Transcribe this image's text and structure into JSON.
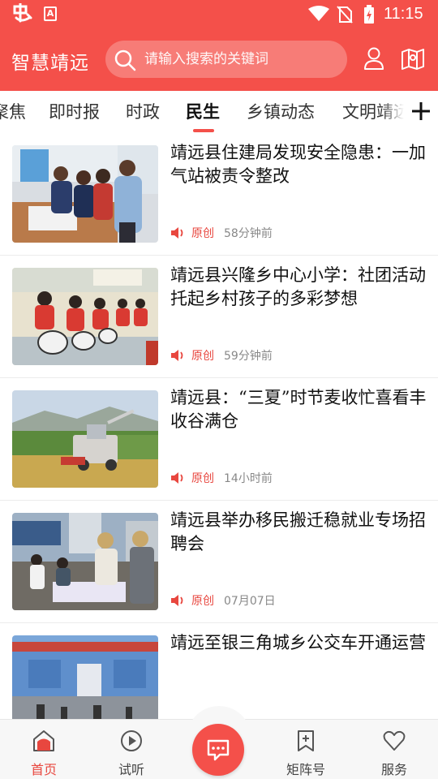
{
  "status_bar": {
    "app_icon": "dang-logo-icon",
    "badge": "A",
    "time": "11:15",
    "icons": [
      "wifi-icon",
      "no-sim-icon",
      "battery-charging-icon"
    ]
  },
  "header": {
    "brand": "智慧靖远",
    "search_placeholder": "请输入搜索的关键词",
    "icons": [
      "user-icon",
      "map-icon"
    ]
  },
  "tabs": [
    "聚焦",
    "即时报",
    "时政",
    "民生",
    "乡镇动态",
    "文明靖远"
  ],
  "active_tab": "民生",
  "news": [
    {
      "title": "靖远县住建局发现安全隐患：一加气站被责令整改",
      "tag": "原创",
      "time": "58分钟前"
    },
    {
      "title": "靖远县兴隆乡中心小学：社团活动托起乡村孩子的多彩梦想",
      "tag": "原创",
      "time": "59分钟前"
    },
    {
      "title": "靖远县：“三夏”时节麦收忙喜看丰收谷满仓",
      "tag": "原创",
      "time": "14小时前"
    },
    {
      "title": "靖远县举办移民搬迁稳就业专场招聘会",
      "tag": "原创",
      "time": "07月07日"
    },
    {
      "title": "靖远至银三角城乡公交车开通运营",
      "tag": "",
      "time": ""
    }
  ],
  "bottom_nav": [
    {
      "label": "首页",
      "icon": "home-icon",
      "active": true
    },
    {
      "label": "试听",
      "icon": "play-icon",
      "active": false
    },
    {
      "label": "",
      "icon": "chat-icon",
      "active": false
    },
    {
      "label": "矩阵号",
      "icon": "bookmark-plus-icon",
      "active": false
    },
    {
      "label": "服务",
      "icon": "heart-icon",
      "active": false
    }
  ],
  "colors": {
    "accent": "#f4504a",
    "tag": "#e8473f"
  }
}
